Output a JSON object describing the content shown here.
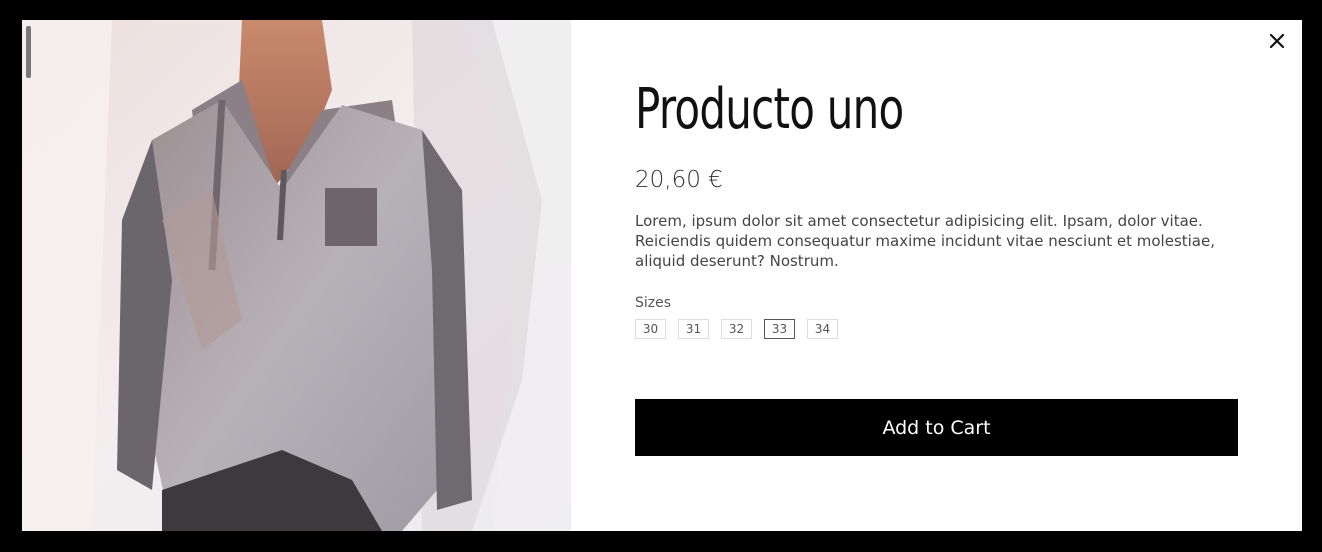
{
  "product": {
    "name": "Producto uno",
    "price": "20,60 €",
    "description": "Lorem, ipsum dolor sit amet consectetur adipisicing elit. Ipsam, dolor vitae. Reiciendis quidem consequatur maxime incidunt vitae nesciunt et molestiae, aliquid deserunt? Nostrum.",
    "image_icon": "product-photo"
  },
  "sizes": {
    "label": "Sizes",
    "options": [
      "30",
      "31",
      "32",
      "33",
      "34"
    ],
    "selected": "33"
  },
  "actions": {
    "add_to_cart_label": "Add to Cart",
    "close_icon": "close-icon"
  },
  "colors": {
    "overlay": "#000000",
    "button": "#000000",
    "button_text": "#ffffff"
  }
}
